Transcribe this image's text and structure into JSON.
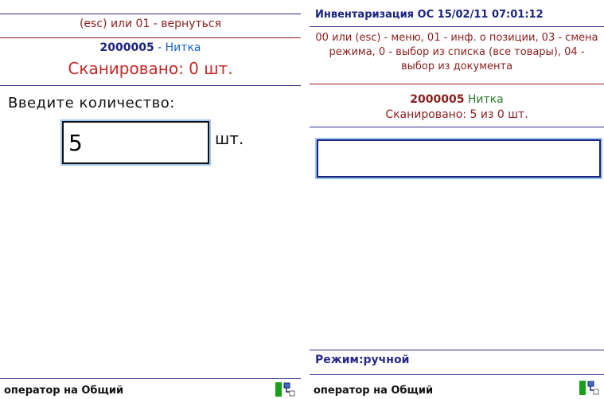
{
  "left": {
    "hint": "(esc) или 01 - вернуться",
    "item_code": "2000005",
    "item_separator": " - ",
    "item_name": "Нитка",
    "scanned": "Сканировано: 0 шт.",
    "prompt": "Введите количество:",
    "quantity_value": "5",
    "unit": "шт.",
    "footer": "оператор на Общий"
  },
  "right": {
    "title": "Инвентаризация ОС 15/02/11 07:01:12",
    "hint": "00 или (esc) - меню, 01 - инф. о позиции, 03 - смена режима, 0 - выбор из списка (все товары), 04 - выбор из документа",
    "item_code": "2000005",
    "item_name": "Нитка",
    "scanned": "Сканировано:  5 из 0 шт.",
    "input_value": "",
    "mode": "Режим:ручной",
    "footer": "оператор на Общий"
  },
  "colors": {
    "accent_navy": "#1a237e",
    "accent_red": "#8a1e1e",
    "name_green": "#2e7d32",
    "name_blue": "#1565c0",
    "focus_ring": "#9ec6f0"
  },
  "icons": [
    "network-status-icon"
  ]
}
